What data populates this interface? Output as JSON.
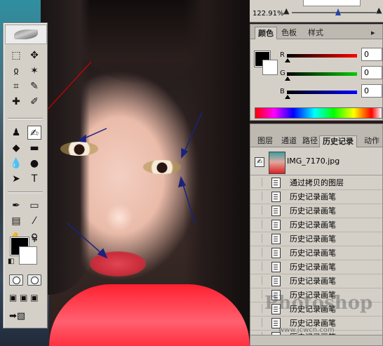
{
  "navigator": {
    "zoom": "122.91%"
  },
  "color_panel": {
    "tabs": [
      "颜色",
      "色板",
      "样式"
    ],
    "channels": [
      {
        "label": "R",
        "value": "0",
        "color": "#dd0000"
      },
      {
        "label": "G",
        "value": "0",
        "color": "#00aa00"
      },
      {
        "label": "B",
        "value": "0",
        "color": "#0000cc"
      }
    ]
  },
  "history_panel": {
    "tabs": [
      "图层",
      "通道",
      "路径",
      "历史记录",
      "动作"
    ],
    "snapshot_name": "IMG_7170.jpg",
    "items": [
      "通过拷贝的图层",
      "历史记录画笔",
      "历史记录画笔",
      "历史记录画笔",
      "历史记录画笔",
      "历史记录画笔",
      "历史记录画笔",
      "历史记录画笔",
      "历史记录画笔",
      "历史记录画笔",
      "历史记录画笔",
      "历史记录画笔"
    ]
  },
  "watermark": {
    "text": "Photoshop",
    "url": "www.jcwcn.com"
  },
  "toolbox": {
    "tools": [
      {
        "name": "marquee",
        "glyph": "⬚"
      },
      {
        "name": "move",
        "glyph": "✥"
      },
      {
        "name": "lasso",
        "glyph": "ჲ"
      },
      {
        "name": "magic-wand",
        "glyph": "✶"
      },
      {
        "name": "crop",
        "glyph": "⌗"
      },
      {
        "name": "slice",
        "glyph": "✎"
      },
      {
        "name": "healing",
        "glyph": "✚"
      },
      {
        "name": "brush",
        "glyph": "✐"
      },
      {
        "name": "stamp",
        "glyph": "♟"
      },
      {
        "name": "history-brush",
        "glyph": "✍"
      },
      {
        "name": "eraser",
        "glyph": "◆"
      },
      {
        "name": "gradient",
        "glyph": "▬"
      },
      {
        "name": "blur",
        "glyph": "💧"
      },
      {
        "name": "dodge",
        "glyph": "●"
      },
      {
        "name": "path-select",
        "glyph": "➤"
      },
      {
        "name": "type",
        "glyph": "T"
      },
      {
        "name": "pen",
        "glyph": "✒"
      },
      {
        "name": "shape",
        "glyph": "▭"
      },
      {
        "name": "notes",
        "glyph": "▤"
      },
      {
        "name": "eyedropper",
        "glyph": "⁄"
      },
      {
        "name": "hand",
        "glyph": "✋"
      },
      {
        "name": "zoom",
        "glyph": "⚲"
      }
    ]
  }
}
